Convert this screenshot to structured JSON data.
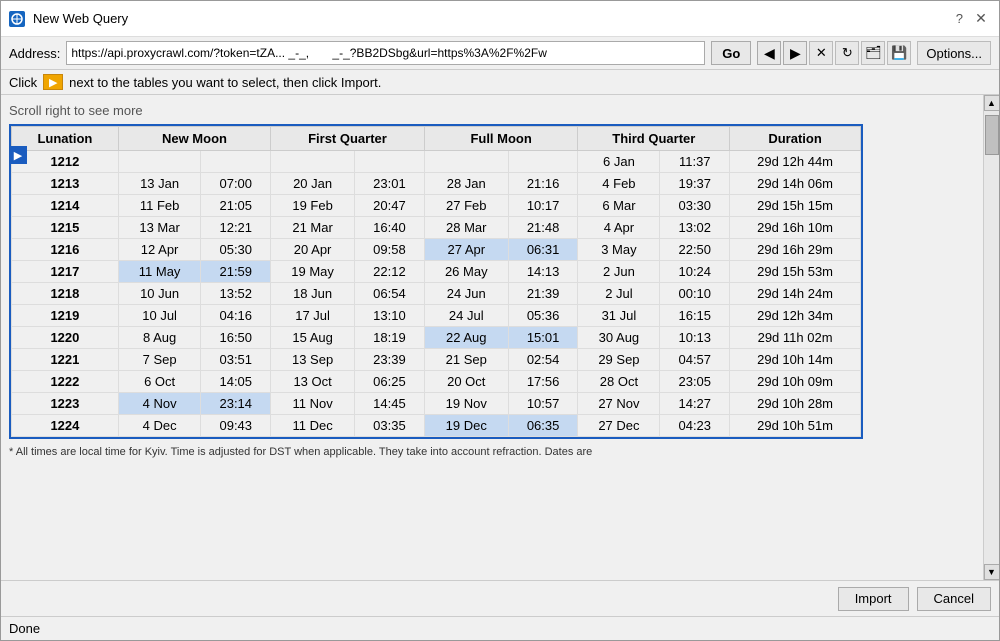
{
  "window": {
    "title": "New Web Query",
    "help_label": "?",
    "close_label": "✕",
    "minimize_label": "─"
  },
  "address_bar": {
    "label": "Address:",
    "value": "https://api.proxycrawl.com/?token=tZA... _-_,       _-_?BB2DSbg&url=https%3A%2F%2Fw",
    "go_label": "Go",
    "options_label": "Options..."
  },
  "toolbar": {
    "click_label": "Click",
    "instruction": "next to the tables you want to select, then click Import."
  },
  "scroll_hint": "Scroll right to see more",
  "table": {
    "headers": [
      "Lunation",
      "New Moon",
      "",
      "First Quarter",
      "",
      "Full Moon",
      "",
      "Third Quarter",
      "",
      "Duration"
    ],
    "column_headers": [
      "Lunation",
      "New Moon",
      "First Quarter",
      "Full Moon",
      "Third Quarter",
      "Duration"
    ],
    "rows": [
      {
        "id": "1212",
        "nm_date": "",
        "nm_time": "",
        "fq_date": "",
        "fq_time": "",
        "fm_date": "",
        "fm_time": "",
        "tq_date": "6 Jan",
        "tq_time": "11:37",
        "duration": "29d 12h 44m",
        "highlight": false
      },
      {
        "id": "1213",
        "nm_date": "13 Jan",
        "nm_time": "07:00",
        "fq_date": "20 Jan",
        "fq_time": "23:01",
        "fm_date": "28 Jan",
        "fm_time": "21:16",
        "tq_date": "4 Feb",
        "tq_time": "19:37",
        "duration": "29d 14h 06m",
        "highlight": false
      },
      {
        "id": "1214",
        "nm_date": "11 Feb",
        "nm_time": "21:05",
        "fq_date": "19 Feb",
        "fq_time": "20:47",
        "fm_date": "27 Feb",
        "fm_time": "10:17",
        "tq_date": "6 Mar",
        "tq_time": "03:30",
        "duration": "29d 15h 15m",
        "highlight": false
      },
      {
        "id": "1215",
        "nm_date": "13 Mar",
        "nm_time": "12:21",
        "fq_date": "21 Mar",
        "fq_time": "16:40",
        "fm_date": "28 Mar",
        "fm_time": "21:48",
        "tq_date": "4 Apr",
        "tq_time": "13:02",
        "duration": "29d 16h 10m",
        "highlight": false
      },
      {
        "id": "1216",
        "nm_date": "12 Apr",
        "nm_time": "05:30",
        "fq_date": "20 Apr",
        "fq_time": "09:58",
        "fm_date": "27 Apr",
        "fm_time": "06:31",
        "tq_date": "3 May",
        "tq_time": "22:50",
        "duration": "29d 16h 29m",
        "highlight_fm": true,
        "highlight": false
      },
      {
        "id": "1217",
        "nm_date": "11 May",
        "nm_time": "21:59",
        "fq_date": "19 May",
        "fq_time": "22:12",
        "fm_date": "26 May",
        "fm_time": "14:13",
        "tq_date": "2 Jun",
        "tq_time": "10:24",
        "duration": "29d 15h 53m",
        "highlight_nm": true,
        "highlight": false
      },
      {
        "id": "1218",
        "nm_date": "10 Jun",
        "nm_time": "13:52",
        "fq_date": "18 Jun",
        "fq_time": "06:54",
        "fm_date": "24 Jun",
        "fm_time": "21:39",
        "tq_date": "2 Jul",
        "tq_time": "00:10",
        "duration": "29d 14h 24m",
        "highlight": false
      },
      {
        "id": "1219",
        "nm_date": "10 Jul",
        "nm_time": "04:16",
        "fq_date": "17 Jul",
        "fq_time": "13:10",
        "fm_date": "24 Jul",
        "fm_time": "05:36",
        "tq_date": "31 Jul",
        "tq_time": "16:15",
        "duration": "29d 12h 34m",
        "highlight": false
      },
      {
        "id": "1220",
        "nm_date": "8 Aug",
        "nm_time": "16:50",
        "fq_date": "15 Aug",
        "fq_time": "18:19",
        "fm_date": "22 Aug",
        "fm_time": "15:01",
        "tq_date": "30 Aug",
        "tq_time": "10:13",
        "duration": "29d 11h 02m",
        "highlight_fm": true,
        "highlight": false
      },
      {
        "id": "1221",
        "nm_date": "7 Sep",
        "nm_time": "03:51",
        "fq_date": "13 Sep",
        "fq_time": "23:39",
        "fm_date": "21 Sep",
        "fm_time": "02:54",
        "tq_date": "29 Sep",
        "tq_time": "04:57",
        "duration": "29d 10h 14m",
        "highlight": false
      },
      {
        "id": "1222",
        "nm_date": "6 Oct",
        "nm_time": "14:05",
        "fq_date": "13 Oct",
        "fq_time": "06:25",
        "fm_date": "20 Oct",
        "fm_time": "17:56",
        "tq_date": "28 Oct",
        "tq_time": "23:05",
        "duration": "29d 10h 09m",
        "highlight": false
      },
      {
        "id": "1223",
        "nm_date": "4 Nov",
        "nm_time": "23:14",
        "fq_date": "11 Nov",
        "fq_time": "14:45",
        "fm_date": "19 Nov",
        "fm_time": "10:57",
        "tq_date": "27 Nov",
        "tq_time": "14:27",
        "duration": "29d 10h 28m",
        "highlight_nm": true,
        "highlight": false
      },
      {
        "id": "1224",
        "nm_date": "4 Dec",
        "nm_time": "09:43",
        "fq_date": "11 Dec",
        "fq_time": "03:35",
        "fm_date": "19 Dec",
        "fm_time": "06:35",
        "tq_date": "27 Dec",
        "tq_time": "04:23",
        "duration": "29d 10h 51m",
        "highlight_fm": true,
        "highlight": false
      }
    ]
  },
  "footnote": "* All times are local time for Kyiv. Time is adjusted for DST when applicable. They take into account refraction. Dates are",
  "footnote_link": "DST",
  "footnote_link2": "refraction",
  "status": "Done",
  "buttons": {
    "import_label": "Import",
    "cancel_label": "Cancel"
  }
}
